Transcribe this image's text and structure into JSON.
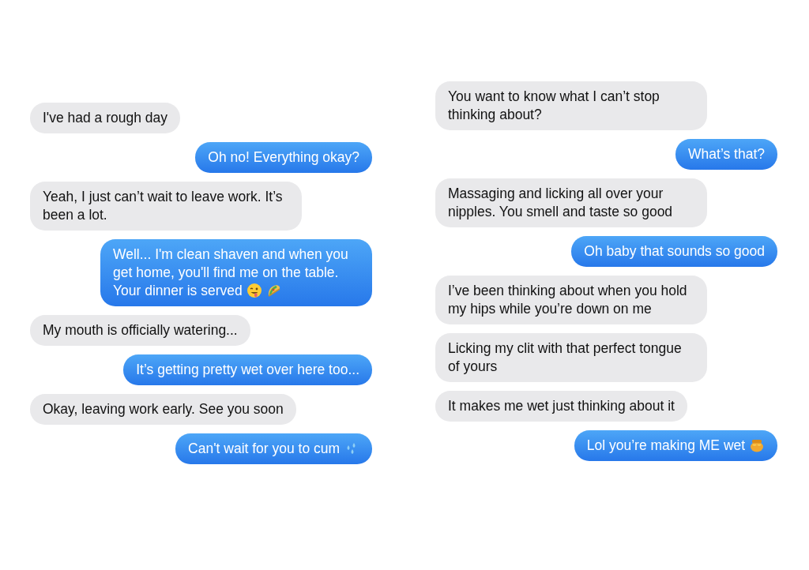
{
  "columns": [
    {
      "messages": [
        {
          "kind": "received",
          "text": "I've had a rough day"
        },
        {
          "kind": "sent",
          "text": "Oh no! Everything okay?"
        },
        {
          "kind": "received",
          "text": "Yeah, I just can’t wait to leave work. It’s been a lot."
        },
        {
          "kind": "sent",
          "text": "Well... I'm clean shaven and when you get home, you'll find me on the table. Your dinner is served",
          "icons": [
            {
              "kind": "face"
            },
            {
              "kind": "taco"
            }
          ]
        },
        {
          "kind": "received",
          "text": "My mouth is officially watering..."
        },
        {
          "kind": "sent",
          "text": "It’s getting pretty wet over here too..."
        },
        {
          "kind": "received",
          "text": "Okay, leaving work early. See you soon"
        },
        {
          "kind": "sent",
          "text": "Can't wait for you to cum",
          "icons": [
            {
              "kind": "droplets"
            }
          ]
        }
      ]
    },
    {
      "messages": [
        {
          "kind": "received",
          "text": "You want to know what I can’t stop thinking about?"
        },
        {
          "kind": "sent",
          "text": "What’s that?"
        },
        {
          "kind": "received",
          "text": "Massaging and licking all over your nipples. You smell and taste so good"
        },
        {
          "kind": "sent",
          "text": "Oh baby that sounds so good"
        },
        {
          "kind": "received",
          "text": "I’ve been thinking about when you hold my hips while you’re down on me"
        },
        {
          "kind": "received",
          "text": "Licking my clit with that perfect tongue of yours"
        },
        {
          "kind": "received",
          "text": "It makes me wet just thinking about it"
        },
        {
          "kind": "sent",
          "text": "Lol you’re making ME wet",
          "icons": [
            {
              "kind": "honeypot"
            }
          ]
        }
      ]
    }
  ]
}
